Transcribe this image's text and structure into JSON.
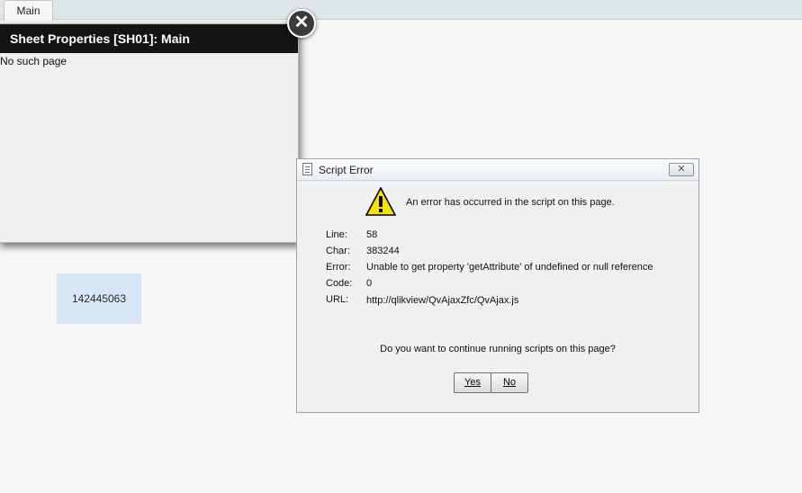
{
  "tabs": [
    {
      "label": "Main"
    }
  ],
  "sheet_properties": {
    "title": "Sheet Properties [SH01]: Main",
    "message": "No such page",
    "close_icon": "close-icon"
  },
  "number_box": {
    "value": "142445063"
  },
  "script_error": {
    "title": "Script Error",
    "headline": "An error has occurred in the script on this page.",
    "details": [
      {
        "label": "Line:",
        "value": "58"
      },
      {
        "label": "Char:",
        "value": "383244"
      },
      {
        "label": "Error:",
        "value": "Unable to get property 'getAttribute' of undefined or null reference"
      },
      {
        "label": "Code:",
        "value": "0"
      },
      {
        "label": "URL:",
        "value": "http://qlikview/QvAjaxZfc/QvAjax.js"
      }
    ],
    "question": "Do you want to continue running scripts on this page?",
    "yes_label": "Yes",
    "no_label": "No"
  },
  "colors": {
    "header_bg": "#141414",
    "number_box_bg": "#d6e6f6",
    "warning_yellow": "#f5e400"
  }
}
